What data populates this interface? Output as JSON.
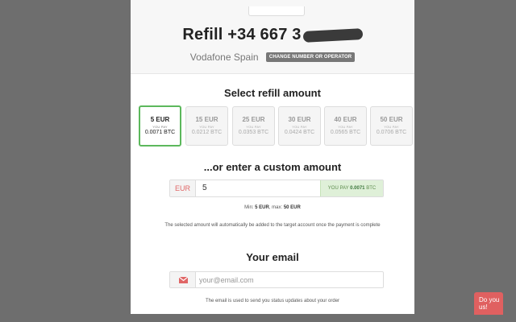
{
  "header": {
    "refill_prefix": "Refill +34 667 3",
    "operator": "Vodafone Spain",
    "change_button": "CHANGE NUMBER OR OPERATOR"
  },
  "refill_section": {
    "title": "Select refill amount",
    "you_pay_label": "YOU PAY",
    "amounts": [
      {
        "eur": "5 EUR",
        "btc": "0.0071 BTC",
        "selected": true
      },
      {
        "eur": "15 EUR",
        "btc": "0.0212 BTC",
        "selected": false
      },
      {
        "eur": "25 EUR",
        "btc": "0.0353 BTC",
        "selected": false
      },
      {
        "eur": "30 EUR",
        "btc": "0.0424 BTC",
        "selected": false
      },
      {
        "eur": "40 EUR",
        "btc": "0.0565 BTC",
        "selected": false
      },
      {
        "eur": "50 EUR",
        "btc": "0.0706 BTC",
        "selected": false
      }
    ]
  },
  "custom_section": {
    "title": "...or enter a custom amount",
    "currency": "EUR",
    "value": "5",
    "you_pay_label": "YOU PAY",
    "you_pay_value": "0.0071",
    "you_pay_unit": "BTC",
    "min_label": "Min:",
    "min_value": "5 EUR",
    "max_label": ", max:",
    "max_value": "50 EUR",
    "note": "The selected amount will automatically be added to the target account once the payment is complete"
  },
  "email_section": {
    "title": "Your email",
    "placeholder": "your@email.com",
    "note": "The email is used to send you status updates about your order"
  },
  "chat": {
    "label_line1": "Do you",
    "label_line2": "us!"
  },
  "colors": {
    "selected_border": "#5cb85c",
    "currency_text": "#e06666",
    "youpay_bg": "#dff0d8",
    "chat_bg": "#e06060"
  }
}
